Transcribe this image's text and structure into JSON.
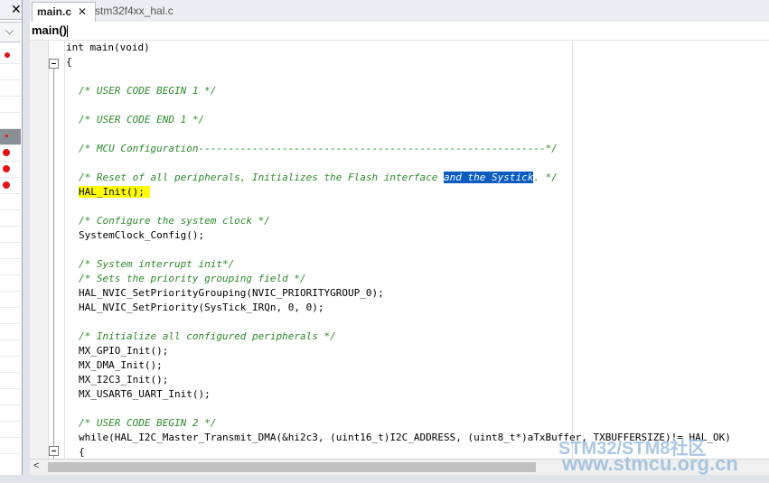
{
  "left_panel": {
    "close_glyph": "✕",
    "dropdown_glyph": "⌵"
  },
  "editor": {
    "tabs": [
      {
        "label": "main.c",
        "active": true,
        "close": "✕"
      },
      {
        "label": "stm32f4xx_hal.c",
        "active": false
      }
    ],
    "function_bar": "main()",
    "code": {
      "l1": "int main(void)",
      "l2": "{",
      "c_begin1": "/* USER CODE BEGIN 1 */",
      "c_end1": "/* USER CODE END 1 */",
      "c_mcu": "/* MCU Configuration----------------------------------------------------------*/",
      "c_reset_a": "/* Reset of all peripherals, Initializes the Flash interface ",
      "c_reset_sel": "and the Systick",
      "c_reset_b": ". */",
      "hal_init": "HAL_Init();",
      "c_clock": "/* Configure the system clock */",
      "sysclock": "SystemClock_Config();",
      "c_sysint": "/* System interrupt init*/",
      "c_prio": "/* Sets the priority grouping field */",
      "nvic_group": "HAL_NVIC_SetPriorityGrouping(NVIC_PRIORITYGROUP_0);",
      "nvic_prio_a": "HAL_NVIC_SetPriority(SysTick_IRQn, ",
      "nvic_prio_0a": "0",
      "nvic_prio_mid": ", ",
      "nvic_prio_0b": "0",
      "nvic_prio_b": ");",
      "c_periph": "/* Initialize all configured peripherals */",
      "gpio": "MX_GPIO_Init();",
      "dma": "MX_DMA_Init();",
      "i2c": "MX_I2C3_Init();",
      "usart": "MX_USART6_UART_Init();",
      "c_begin2": "/* USER CODE BEGIN 2 */",
      "while_line": "while(HAL_I2C_Master_Transmit_DMA(&hi2c3, (uint16_t)I2C_ADDRESS, (uint8_t*)aTxBuffer, TXBUFFERSIZE)!= HAL_OK)",
      "brace2": "{"
    }
  },
  "scrollbar": {
    "left_arrow": "<"
  },
  "watermark": {
    "line1": "STM32/STM8社区",
    "line2": "www.stmcu.org.cn"
  },
  "colors": {
    "comment": "#2b8a2b",
    "selection": "#0a5cc1",
    "highlight": "#ffff00",
    "breakpoint": "#e3141a"
  }
}
